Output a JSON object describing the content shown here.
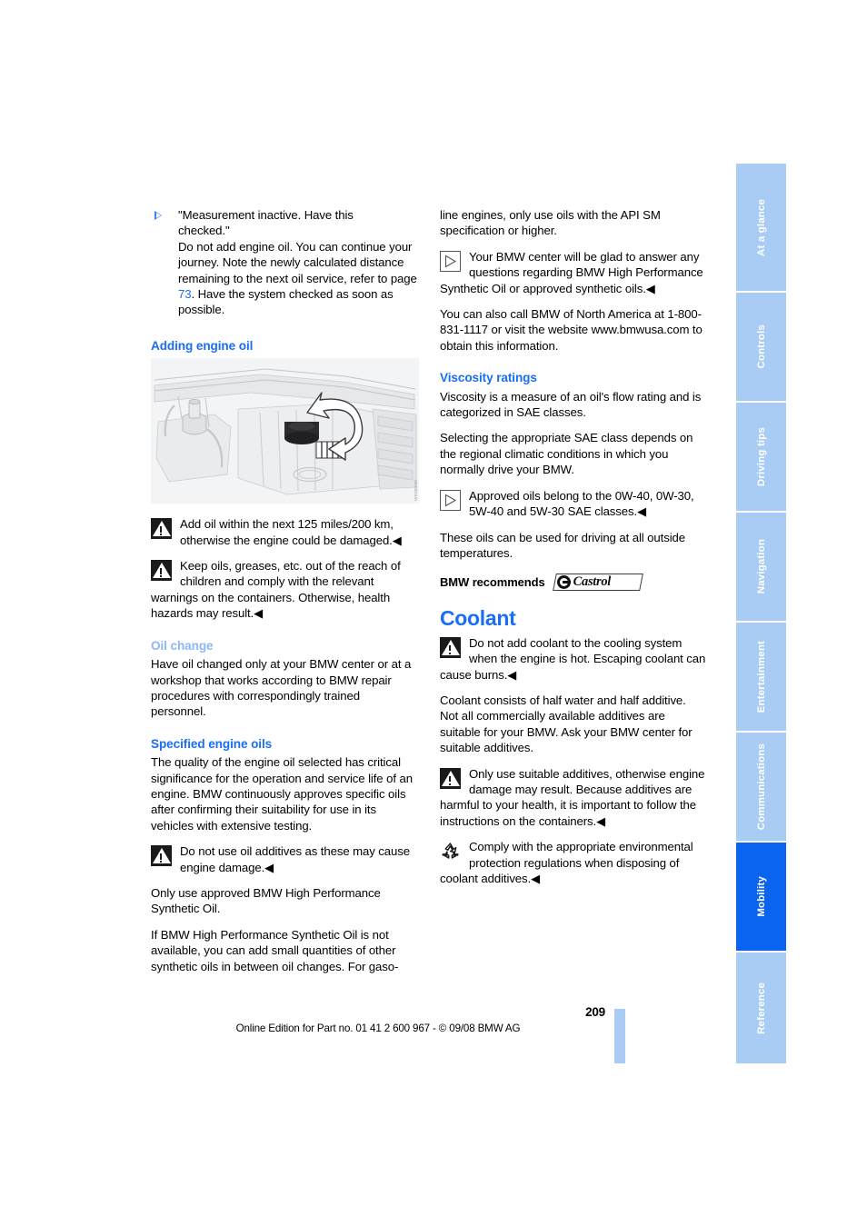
{
  "page": {
    "number": "209",
    "footer": "Online Edition for Part no. 01 41 2 600 967  - © 09/08 BMW AG",
    "figure_code": "WKM0209"
  },
  "colors": {
    "heading_blue": "#1a6ef5",
    "heading_blue_faded": "#8cb8f5",
    "tab_blue": "#a8ccf4",
    "tab_active_blue": "#0a64f0",
    "figure_background": "#f3f4f5"
  },
  "left_column": {
    "bullet": {
      "icon": "triangle-right-icon",
      "text": "\"Measurement inactive. Have this checked.\" Do not add engine oil. You can continue your journey. Note the newly calculated distance remaining to the next oil service, refer to page 73. Have the system checked as soon as possible.",
      "line1": "\"Measurement inactive. Have this",
      "line2": "checked.\"",
      "body_before_link": "Do not add engine oil. You can continue your journey. Note the newly calculated distance remaining to the next oil service, refer to page ",
      "page_link": "73",
      "body_after_link": ". Have the system checked as soon as possible."
    },
    "heading_adding_engine_oil": "Adding engine oil",
    "figure_alt": "Engine compartment showing oil filler cap with turn arrow",
    "warning_add_oil": "Add oil within the next 125 miles/200 km, otherwise the engine could be damaged.◀",
    "warning_keep_oils": "Keep oils, greases, etc. out of the reach of children and comply with the relevant warnings on the containers. Otherwise, health hazards may result.◀",
    "heading_oil_change": "Oil change",
    "oil_change_text": "Have oil changed only at your BMW center or at a workshop that works according to BMW repair procedures with correspondingly trained personnel.",
    "heading_specified_engine_oils": "Specified engine oils",
    "specified_text": "The quality of the engine oil selected has critical significance for the operation and service life of an engine. BMW continuously approves specific oils after confirming their suitability for use in its vehicles with extensive testing.",
    "warning_no_additives": "Do not use oil additives as these may cause engine damage.◀",
    "only_approved_text": "Only use approved BMW High Performance Synthetic Oil.",
    "if_not_available_text": "If BMW High Performance Synthetic Oil is not available, you can add small quantities of other synthetic oils in between oil changes. For gaso-"
  },
  "right_column": {
    "continuation_text": "line engines, only use oils with the API SM specification or higher.",
    "note_bmw_center": "Your BMW center will be glad to answer any questions regarding BMW High Performance Synthetic Oil or approved synthetic oils.◀",
    "call_text": "You can also call BMW of North America at 1-800-831-1117 or visit the website www.bmwusa.com to obtain this information.",
    "heading_viscosity": "Viscosity ratings",
    "viscosity_text_1": "Viscosity is a measure of an oil's flow rating and is categorized in SAE classes.",
    "viscosity_text_2": "Selecting the appropriate SAE class depends on the regional climatic conditions in which you normally drive your BMW.",
    "note_approved_oils": "Approved oils belong to the 0W-40, 0W-30, 5W-40 and 5W-30 SAE classes.◀",
    "all_temperatures_text": "These oils can be used for driving at all outside temperatures.",
    "recommend_label": "BMW recommends",
    "recommend_brand": "Castrol",
    "heading_coolant": "Coolant",
    "warning_hot_engine": "Do not add coolant to the cooling system when the engine is hot. Escaping coolant can cause burns.◀",
    "coolant_text": "Coolant consists of half water and half additive. Not all commercially available additives are suitable for your BMW. Ask your BMW center for suitable additives.",
    "warning_suitable_additives": "Only use suitable additives, otherwise engine damage may result. Because additives are harmful to your health, it is important to follow the instructions on the containers.◀",
    "note_environment": "Comply with the appropriate environmental protection regulations when disposing of coolant additives.◀"
  },
  "tabs": [
    {
      "label": "At a glance",
      "active": false
    },
    {
      "label": "Controls",
      "active": false
    },
    {
      "label": "Driving tips",
      "active": false
    },
    {
      "label": "Navigation",
      "active": false
    },
    {
      "label": "Entertainment",
      "active": false
    },
    {
      "label": "Communications",
      "active": false
    },
    {
      "label": "Mobility",
      "active": true
    },
    {
      "label": "Reference",
      "active": false
    }
  ]
}
